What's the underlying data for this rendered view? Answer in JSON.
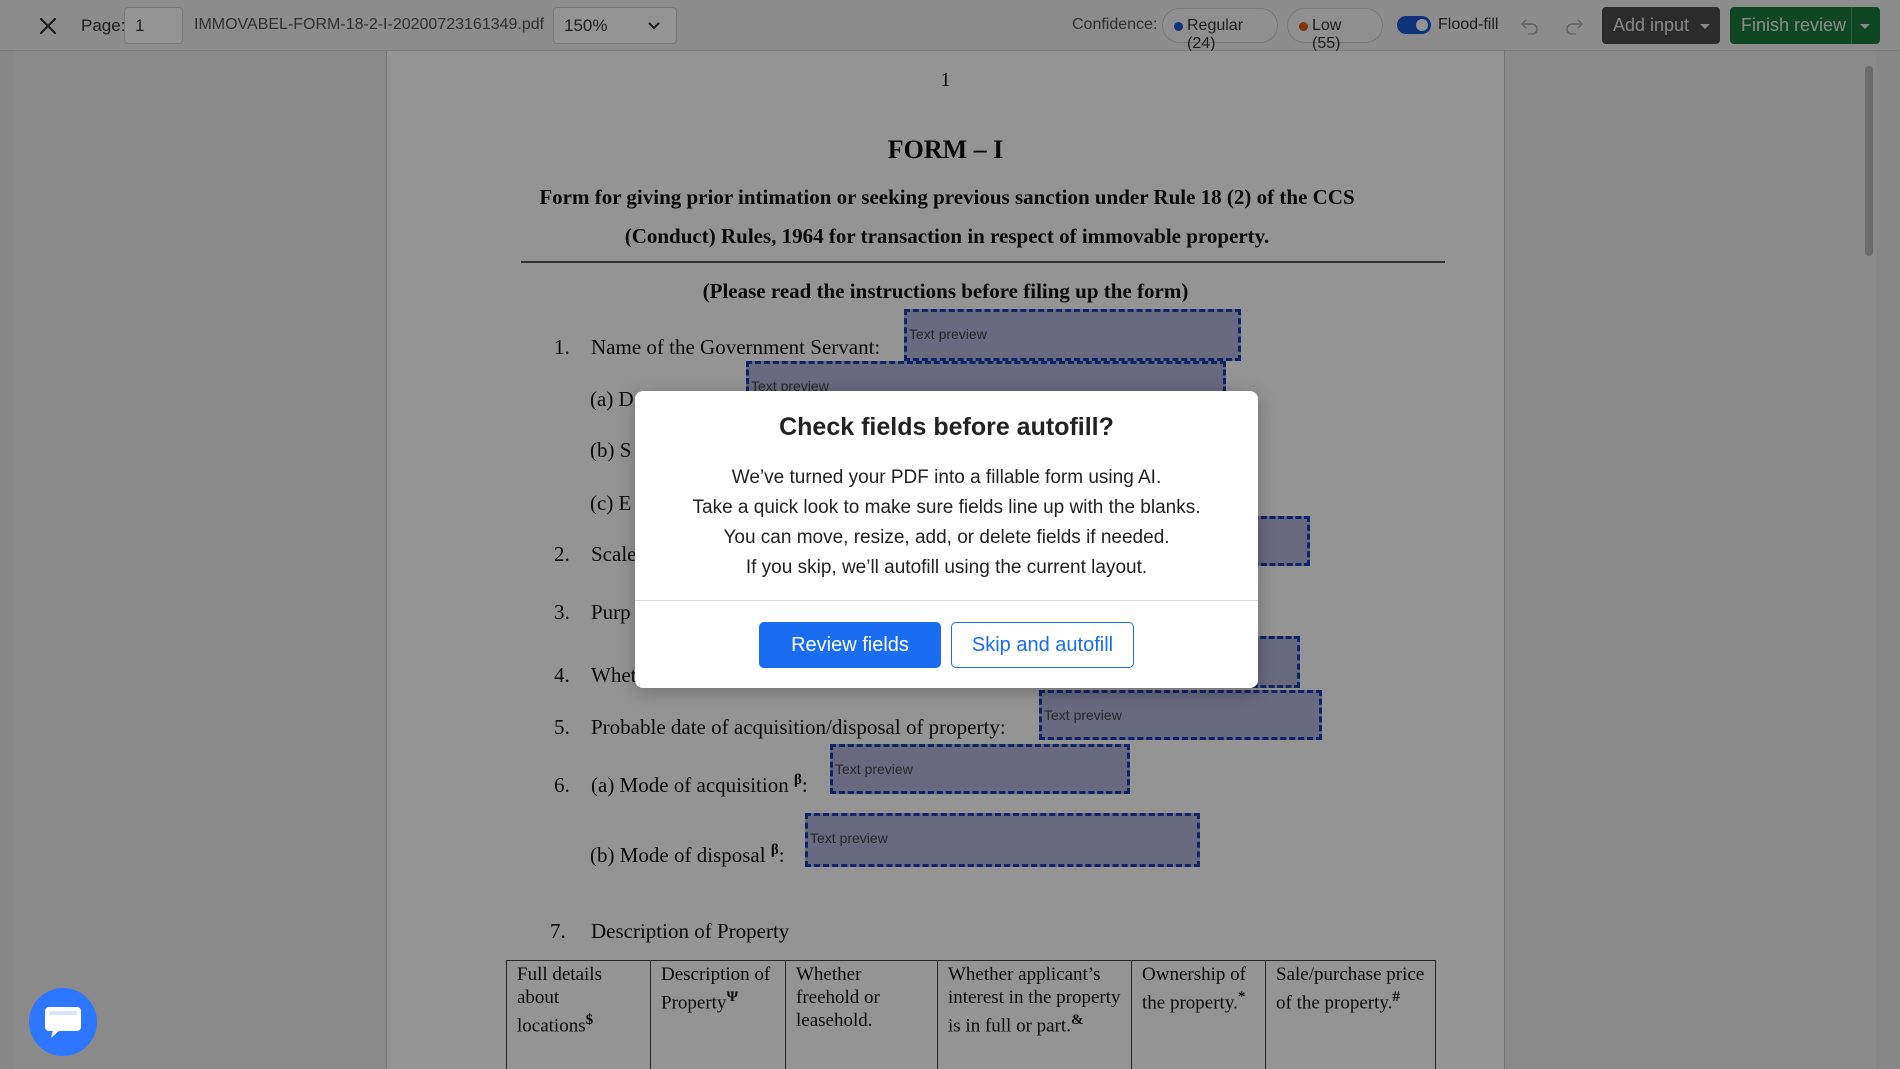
{
  "toolbar": {
    "page_label": "Page:",
    "page_value": "1",
    "filename": "IMMOVABEL-FORM-18-2-I-20200723161349.pdf",
    "zoom": "150%",
    "confidence_label": "Confidence:",
    "regular_pill": "Regular (24)",
    "low_pill": "Low (55)",
    "flood_fill_label": "Flood-fill",
    "add_input_label": "Add input",
    "finish_review_label": "Finish review",
    "colors": {
      "regular_dot": "#1a57d6",
      "low_dot": "#e05a10",
      "finish_bg": "#1b7a3e",
      "add_bg": "#4b4b4b"
    },
    "icons": [
      "close-icon",
      "chevron-down-icon",
      "undo-icon",
      "redo-icon",
      "caret-down-icon"
    ]
  },
  "document": {
    "page_number": "1",
    "form_title": "FORM – I",
    "form_subtitle_line1": "Form for giving prior intimation or seeking previous sanction under Rule 18 (2) of the CCS",
    "form_subtitle_line2": "(Conduct) Rules, 1964 for transaction in respect of immovable property.",
    "instructions": "(Please read the instructions before filing up the form)",
    "items": {
      "i1_num": "1.",
      "i1_text": "Name of the Government Servant:",
      "ia_text": "(a) D",
      "ib_text": "(b) S",
      "ic_text": "(c) E",
      "i2_num": "2.",
      "i2_text": "Scale",
      "i3_num": "3.",
      "i3_text": "Purp",
      "i4_num": "4.",
      "i4_text": "Whet",
      "i5_num": "5.",
      "i5_text": "Probable date of acquisition/disposal of property:",
      "i6_num": "6.",
      "i6a_text": "(a) Mode of acquisition",
      "i6a_sup": "β",
      "i6a_colon": ":",
      "i6b_text": "(b) Mode of disposal",
      "i6b_sup": "β",
      "i6b_colon": ":",
      "i7_num": "7.",
      "i7_text": "Description of Property"
    },
    "field_placeholder": "Text preview",
    "table_headers": [
      {
        "text": "Full details about locations",
        "sup": "$"
      },
      {
        "text": "Description of Property",
        "sup": "Ψ"
      },
      {
        "text": "Whether freehold or leasehold.",
        "sup": ""
      },
      {
        "text": "Whether applicant’s interest in the property is in full or part.",
        "sup": "&"
      },
      {
        "text": "Ownership of the property.",
        "sup": "*"
      },
      {
        "text": "Sale/purchase price of the property.",
        "sup": "#"
      }
    ]
  },
  "modal": {
    "title": "Check fields before autofill?",
    "line1": "We’ve turned your PDF into a fillable form using AI.",
    "line2": "Take a quick look to make sure fields line up with the blanks.",
    "line3": "You can move, resize, add, or delete fields if needed.",
    "line4": "If you skip, we’ll autofill using the current layout.",
    "primary_button": "Review fields",
    "secondary_button": "Skip and autofill"
  },
  "chat": {
    "icon": "chat-icon"
  }
}
